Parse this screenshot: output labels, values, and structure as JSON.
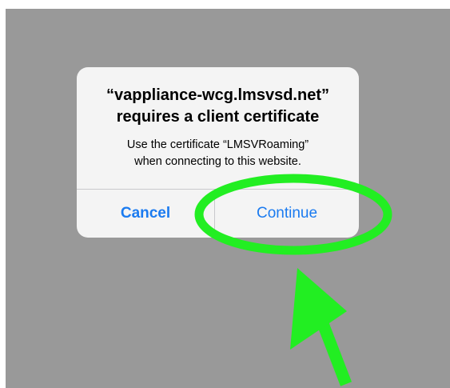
{
  "alert": {
    "title_line1": "“vappliance-wcg.lmsvsd.net”",
    "title_line2": "requires a client certificate",
    "message_line1": "Use the certificate “LMSVRoaming”",
    "message_line2": "when connecting to this website.",
    "cancel_label": "Cancel",
    "continue_label": "Continue"
  },
  "colors": {
    "backdrop": "#999999",
    "alert_background": "#f4f4f4",
    "button_text": "#1b7bf0",
    "annotation": "#22ee22"
  },
  "annotation": {
    "highlight_shape": "ellipse",
    "pointer_shape": "arrow",
    "target": "Continue"
  }
}
